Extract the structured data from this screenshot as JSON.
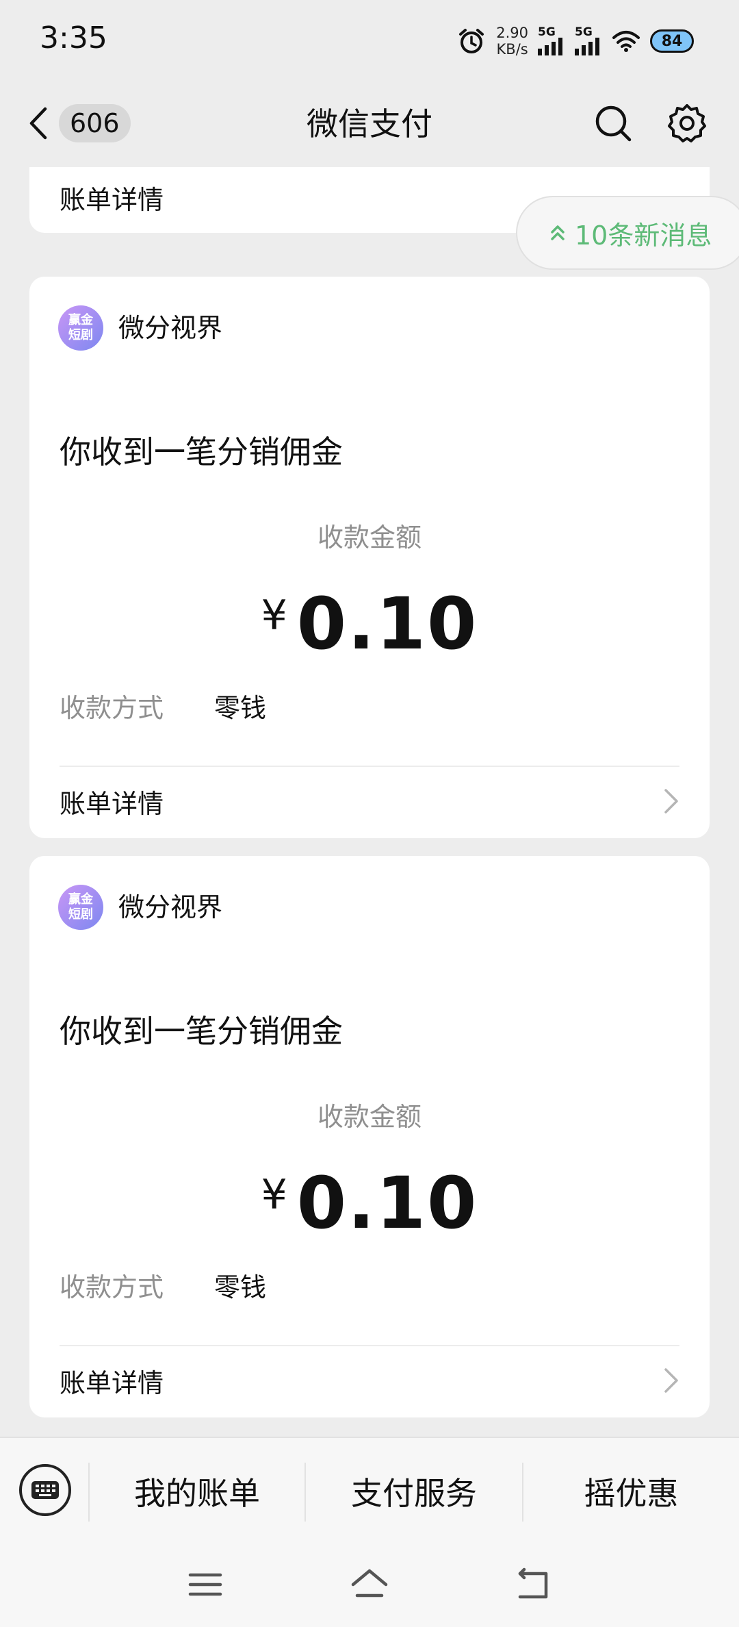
{
  "status_bar": {
    "time": "3:35",
    "net_speed_value": "2.90",
    "net_speed_unit": "KB/s",
    "signal1_tag": "5G",
    "signal2_tag": "5G",
    "battery": "84"
  },
  "header": {
    "unread_count": "606",
    "title": "微信支付"
  },
  "top_card": {
    "detail_label": "账单详情"
  },
  "new_messages": {
    "label": "10条新消息"
  },
  "cards": [
    {
      "merchant_logo_line1": "赢金",
      "merchant_logo_line2": "短剧",
      "merchant_name": "微分视界",
      "headline": "你收到一笔分销佣金",
      "amount_label": "收款金额",
      "currency": "¥",
      "amount": "0.10",
      "method_label": "收款方式",
      "method_value": "零钱",
      "detail_label": "账单详情"
    },
    {
      "merchant_logo_line1": "赢金",
      "merchant_logo_line2": "短剧",
      "merchant_name": "微分视界",
      "headline": "你收到一笔分销佣金",
      "amount_label": "收款金额",
      "currency": "¥",
      "amount": "0.10",
      "method_label": "收款方式",
      "method_value": "零钱",
      "detail_label": "账单详情"
    }
  ],
  "bottom_menu": {
    "items": [
      "我的账单",
      "支付服务",
      "摇优惠"
    ]
  },
  "colors": {
    "accent_green": "#5dba77",
    "background": "#ededed",
    "card": "#ffffff"
  }
}
